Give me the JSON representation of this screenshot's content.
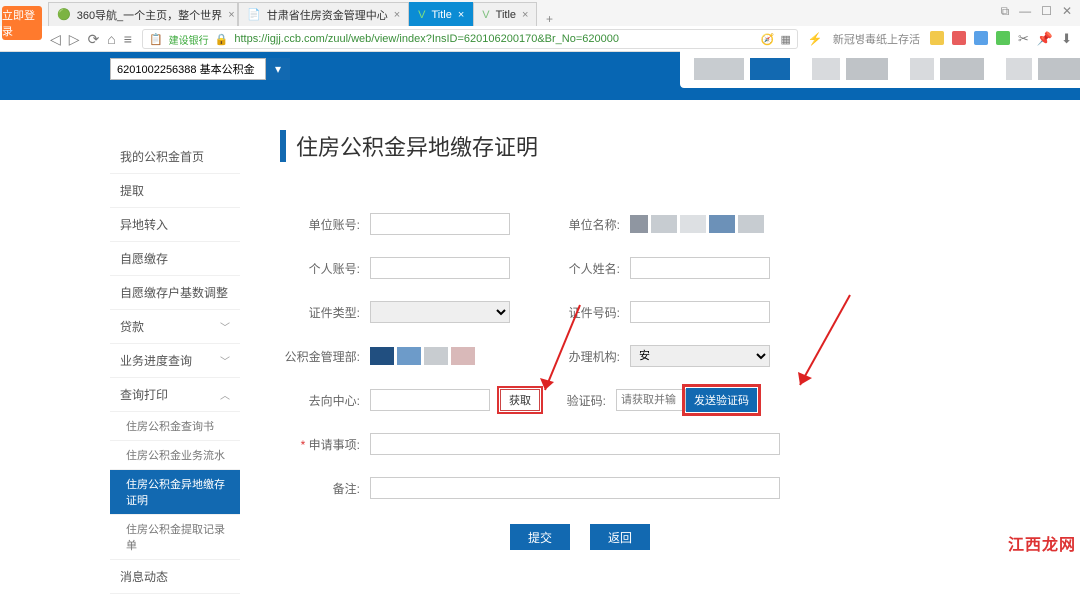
{
  "browser": {
    "login_badge": "立即登录",
    "tabs": [
      {
        "label": "360导航_一个主页，整个世界"
      },
      {
        "label": "甘肃省住房资金管理中心"
      },
      {
        "label": "Title",
        "active": true
      },
      {
        "label": "Title"
      }
    ],
    "url_bank": "建设银行",
    "url": "https://igjj.ccb.com/zuul/web/view/index?InsID=620106200170&Br_No=620000",
    "hint": "新冠병毒纸上存活"
  },
  "selector": {
    "value": "6201002256388 基本公积金"
  },
  "sidebar": {
    "items": [
      {
        "label": "我的公积金首页"
      },
      {
        "label": "提取"
      },
      {
        "label": "异地转入"
      },
      {
        "label": "自愿缴存"
      },
      {
        "label": "自愿缴存户基数调整"
      },
      {
        "label": "贷款",
        "caret": "v"
      },
      {
        "label": "业务进度查询",
        "caret": "v"
      },
      {
        "label": "查询打印",
        "caret": "^"
      },
      {
        "label": "住房公积金查询书",
        "small": true
      },
      {
        "label": "住房公积金业务流水",
        "small": true
      },
      {
        "label": "住房公积金异地缴存证明",
        "small": true,
        "active": true
      },
      {
        "label": "住房公积金提取记录单",
        "small": true
      },
      {
        "label": "消息动态"
      }
    ]
  },
  "page": {
    "title": "住房公积金异地缴存证明"
  },
  "form": {
    "unit_acct": "单位账号:",
    "unit_name": "单位名称:",
    "pers_acct": "个人账号:",
    "pers_name": "个人姓名:",
    "cert_type": "证件类型:",
    "cert_no": "证件号码:",
    "mgmt": "公积金管理部:",
    "agency": "办理机构:",
    "agency_val": "安",
    "dest": "去向中心:",
    "get": "获取",
    "vcode": "验证码:",
    "vcode_ph": "请获取并输",
    "send": "发送验证码",
    "apply": "申请事项:",
    "remark": "备注:",
    "submit": "提交",
    "back": "返回"
  },
  "watermark": "江西龙网"
}
